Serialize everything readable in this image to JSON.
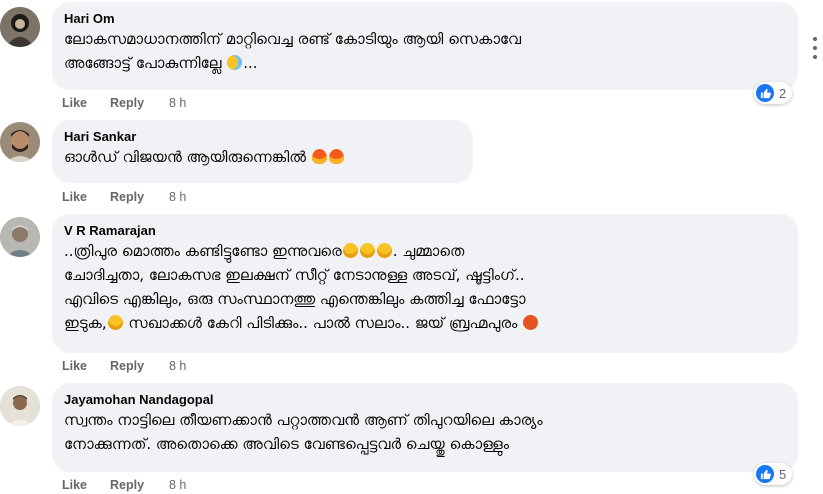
{
  "comments": [
    {
      "author": "Hari Om",
      "text": "ലോകസമാധാനത്തിന് മാറ്റിവെച്ച രണ്ട് കോടിയും ആയി സെകാവേ\nഅങ്ങോട്ട് പോകുന്നില്ലേ",
      "like": "Like",
      "reply": "Reply",
      "time": "8 h",
      "reaction_count": "2"
    },
    {
      "author": "Hari Sankar",
      "text": "ഓൾഡ് വിജയൻ ആയിരുന്നെങ്കിൽ",
      "like": "Like",
      "reply": "Reply",
      "time": "8 h"
    },
    {
      "author": "V R Ramarajan",
      "text_parts": [
        "..ത്രിപുര മൊത്തം കണ്ടിട്ടുണ്ടോ ഇന്നുവരെ",
        ". ചുമ്മാതെ\nചോദിച്ചതാ, ലോകസഭ ഇലക്ഷന് സീറ്റ് നേടാനുള്ള അടവ്, ഷൂട്ടിംഗ്..\nഎവിടെ എങ്കിലും, ഒരു സംസ്ഥാനത്തു എന്തെങ്കിലും കത്തിച്ച ഫോട്ടോ\nഇടുക,",
        " സഖാക്കൾ കേറി പിടിക്കും.. പാൽ സലാം.. ജയ് ബ്രഹ്മപുരം"
      ],
      "like": "Like",
      "reply": "Reply",
      "time": "8 h"
    },
    {
      "author": "Jayamohan Nandagopal",
      "text": "സ്വന്തം നാട്ടിലെ തീയണക്കാൻ പറ്റാത്തവൻ ആണ് തിപുറയിലെ കാര്യം\nനോക്കുന്നത്. അതൊക്കെ അവിടെ വേണ്ടപ്പെട്ടവർ ചെയ്തു കൊള്ളും",
      "like": "Like",
      "reply": "Reply",
      "time": "8 h",
      "reaction_count": "5"
    }
  ],
  "colors": {
    "bubble": "#f0f2f5",
    "meta": "#65676b",
    "like_blue": "#1877f2"
  },
  "icons": {
    "reaction": "like-thumb-icon",
    "more": "more-options-icon"
  }
}
